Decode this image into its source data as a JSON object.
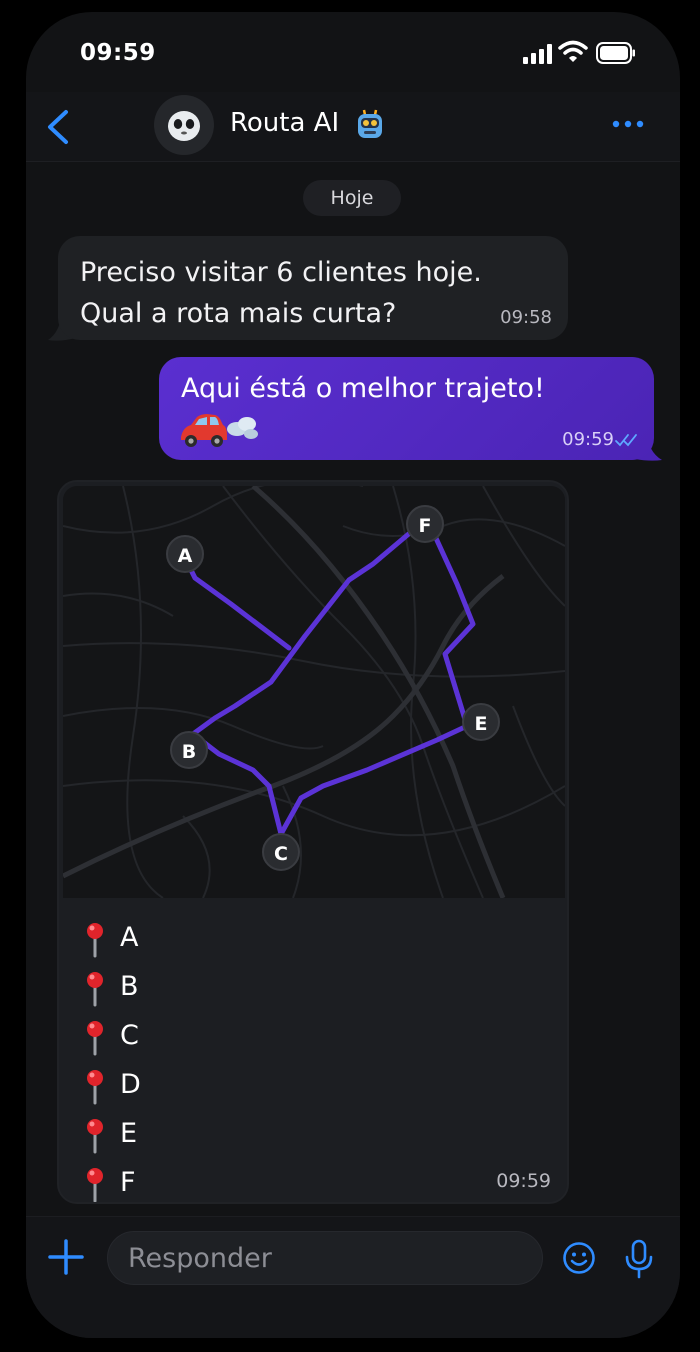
{
  "status_bar": {
    "time": "09:59"
  },
  "header": {
    "contact_name": "Routa AI",
    "avatar_icon": "alien-face-icon",
    "badge_icon": "robot-icon"
  },
  "chat": {
    "date_label": "Hoje",
    "messages": [
      {
        "direction": "incoming",
        "lines": [
          "Preciso visitar 6 clientes hoje.",
          "Qual a rota mais curta?"
        ],
        "time": "09:58"
      },
      {
        "direction": "outgoing",
        "text": "Aqui éstá o melhor trajeto!",
        "emoji": "car-dash-emoji",
        "time": "09:59",
        "status": "read"
      }
    ],
    "route_card": {
      "map_points": [
        "A",
        "B",
        "C",
        "E",
        "F"
      ],
      "stops": [
        "A",
        "B",
        "C",
        "D",
        "E",
        "F"
      ],
      "time": "09:59",
      "route_color": "#5b33d6"
    }
  },
  "input": {
    "placeholder": "Responder"
  },
  "colors": {
    "accent": "#2f8cff",
    "outgoing_bubble": "#5a2fd0",
    "incoming_bubble": "#1f2124",
    "background": "#121315"
  }
}
